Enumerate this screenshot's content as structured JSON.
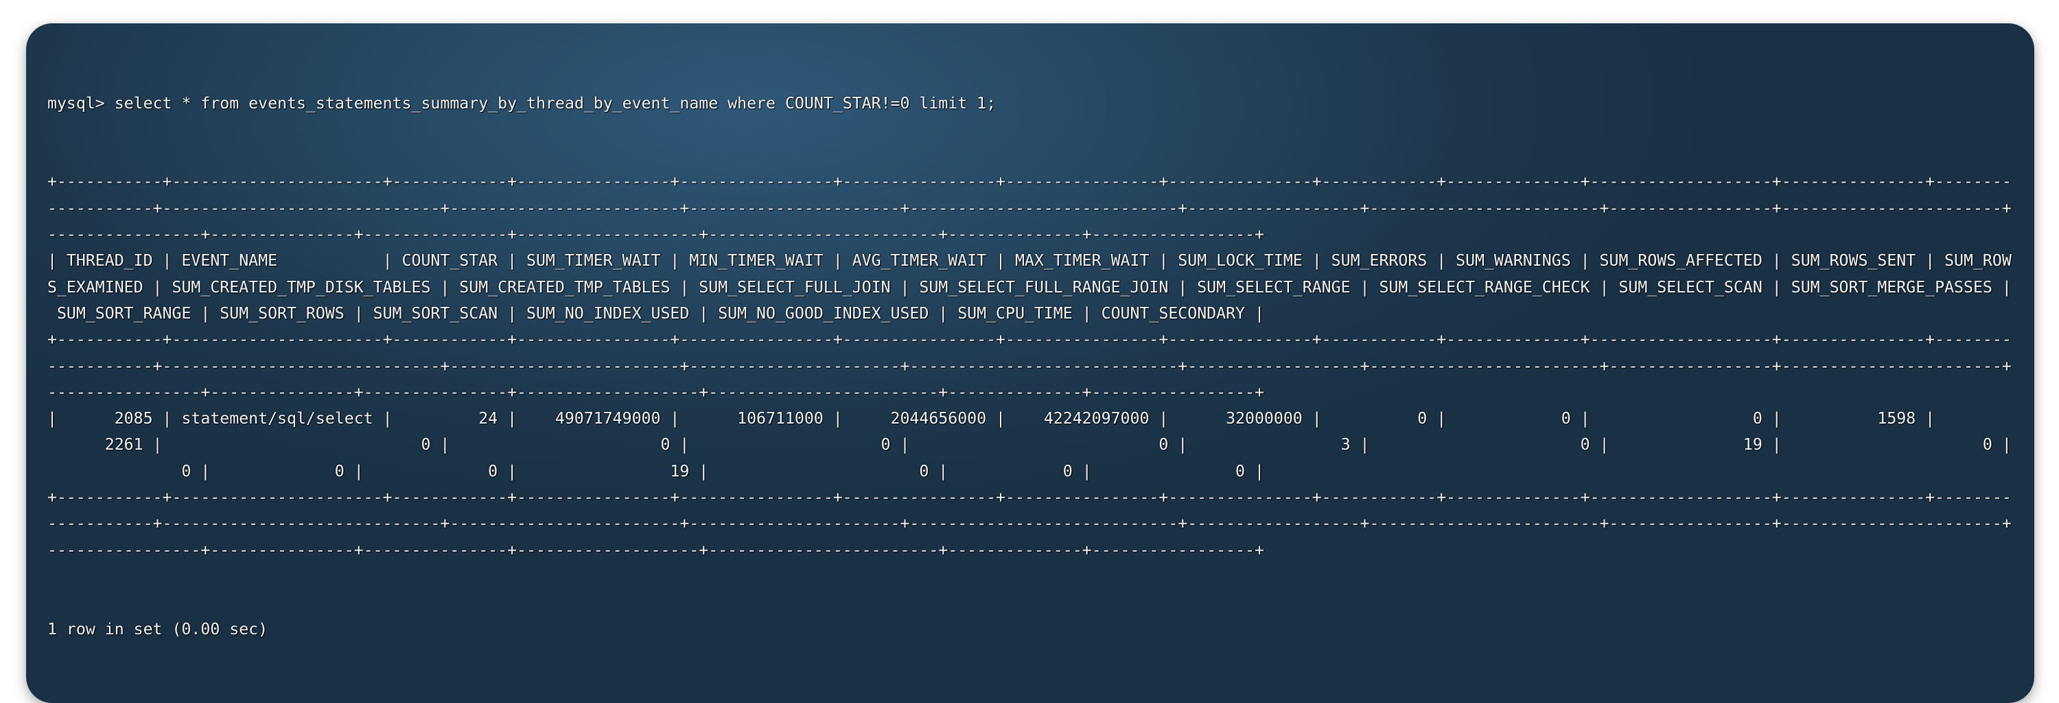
{
  "terminal": {
    "prompt": "mysql> ",
    "command": "select * from events_statements_summary_by_thread_by_event_name where COUNT_STAR!=0 limit 1;",
    "wrap_columns": 205,
    "columns": [
      "THREAD_ID",
      "EVENT_NAME",
      "COUNT_STAR",
      "SUM_TIMER_WAIT",
      "MIN_TIMER_WAIT",
      "AVG_TIMER_WAIT",
      "MAX_TIMER_WAIT",
      "SUM_LOCK_TIME",
      "SUM_ERRORS",
      "SUM_WARNINGS",
      "SUM_ROWS_AFFECTED",
      "SUM_ROWS_SENT",
      "SUM_ROWS_EXAMINED",
      "SUM_CREATED_TMP_DISK_TABLES",
      "SUM_CREATED_TMP_TABLES",
      "SUM_SELECT_FULL_JOIN",
      "SUM_SELECT_FULL_RANGE_JOIN",
      "SUM_SELECT_RANGE",
      "SUM_SELECT_RANGE_CHECK",
      "SUM_SELECT_SCAN",
      "SUM_SORT_MERGE_PASSES",
      "SUM_SORT_RANGE",
      "SUM_SORT_ROWS",
      "SUM_SORT_SCAN",
      "SUM_NO_INDEX_USED",
      "SUM_NO_GOOD_INDEX_USED",
      "SUM_CPU_TIME",
      "COUNT_SECONDARY"
    ],
    "rows": [
      [
        "2085",
        "statement/sql/select",
        "24",
        "49071749000",
        "106711000",
        "2044656000",
        "42242097000",
        "32000000",
        "0",
        "0",
        "0",
        "1598",
        "2261",
        "0",
        "0",
        "0",
        "0",
        "3",
        "0",
        "19",
        "0",
        "0",
        "0",
        "0",
        "19",
        "0",
        "0",
        "0"
      ]
    ],
    "footer": "1 row in set (0.00 sec)"
  }
}
